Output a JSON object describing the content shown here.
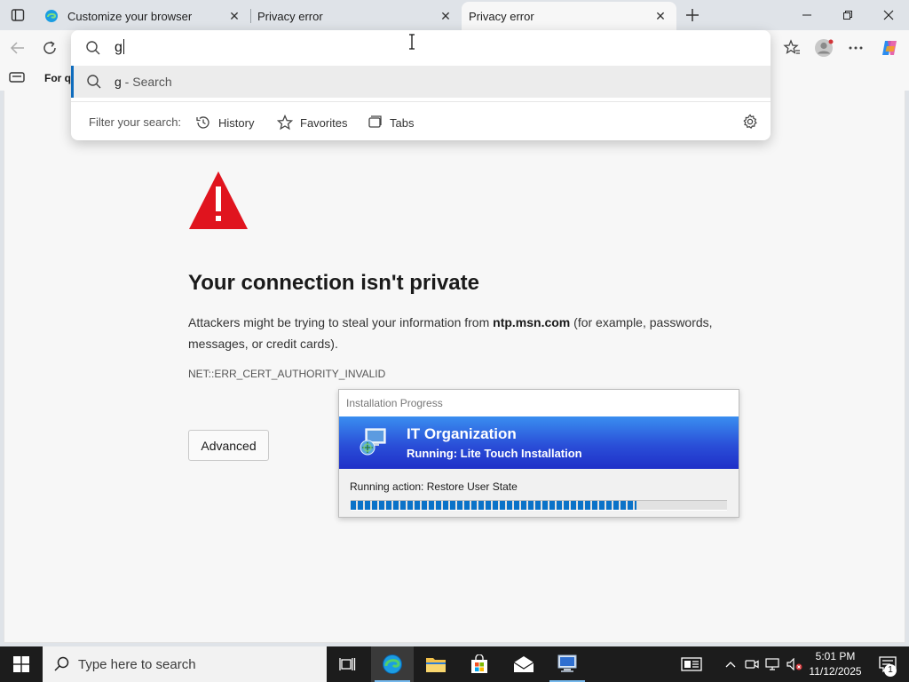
{
  "browser": {
    "tabs": [
      {
        "title": "Customize your browser",
        "active": false
      },
      {
        "title": "Privacy error",
        "active": false
      },
      {
        "title": "Privacy error",
        "active": true
      }
    ],
    "favorites_bar_label": "For qu"
  },
  "omnibox": {
    "query": "g",
    "suggestion": {
      "term": "g",
      "separator": " - ",
      "action": "Search"
    },
    "filter_label": "Filter your search:",
    "filters": [
      "History",
      "Favorites",
      "Tabs"
    ]
  },
  "error_page": {
    "title": "Your connection isn't private",
    "body_prefix": "Attackers might be trying to steal your information from ",
    "host": "ntp.msn.com",
    "body_suffix": " (for example, passwords, messages, or credit cards).",
    "code": "NET::ERR_CERT_AUTHORITY_INVALID",
    "advanced_label": "Advanced"
  },
  "installer": {
    "window_title": "Installation Progress",
    "organization": "IT Organization",
    "status": "Running: Lite Touch Installation",
    "action": "Running action: Restore User State",
    "progress": 0.76
  },
  "taskbar": {
    "search_placeholder": "Type here to search",
    "time": "5:01 PM",
    "date": "11/12/2025",
    "notification_count": "1"
  },
  "colors": {
    "accent": "#0f6cbd",
    "warning_red": "#e0141e",
    "installer_banner": "#2a4fd8",
    "progress_fill": "#0a72c8",
    "taskbar": "#1c1c1c"
  }
}
